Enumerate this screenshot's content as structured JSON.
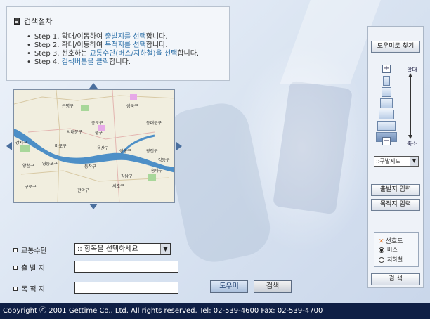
{
  "guide": {
    "title": "검색절차",
    "steps": [
      {
        "pre": "Step 1. 확대/이동하여 ",
        "highlight": "출발지를 선택",
        "post": "합니다."
      },
      {
        "pre": "Step 2. 확대/이동하여 ",
        "highlight": "목적지를 선택",
        "post": "합니다."
      },
      {
        "pre": "Step 3. 선호하는 ",
        "highlight": "교통수단(버스/지하철)을 선택",
        "post": "합니다."
      },
      {
        "pre": "Step 4. ",
        "highlight": "검색버튼을 클릭",
        "post": "합니다."
      }
    ]
  },
  "map": {
    "labels": [
      "은평구",
      "성북구",
      "종로구",
      "서대문구",
      "중구",
      "동대문구",
      "마포구",
      "용산구",
      "성동구",
      "광진구",
      "영등포구",
      "동작구",
      "강남구",
      "송파구",
      "강동구",
      "양천구",
      "구로구",
      "관악구",
      "서초구",
      "강서구"
    ]
  },
  "panel": {
    "help_link": "도우미로 찾기",
    "zoom_in_label": "확대",
    "zoom_out_label": "축소",
    "district_select": "::구발지도",
    "set_origin": "출발지 입력",
    "set_destination": "목적지 입력",
    "preference_title": "선호도",
    "option_bus": "버스",
    "option_subway": "지하철",
    "selected_option": "bus",
    "search_button": "검 색",
    "zoom_level": "7단계 중 7단계"
  },
  "form": {
    "transport_label": "교통수단",
    "transport_select": ":: 항목을 선택하세요",
    "origin_label": "출 발 지",
    "origin_value": "",
    "destination_label": "목 적 지",
    "destination_value": "",
    "help_button": "도우미",
    "search_button": "검색"
  },
  "footer": {
    "copyright": "Copyright ⓒ 2001 Gettime Co., Ltd. All rights reserved. Tel: 02-539-4600 Fax: 02-539-4700"
  }
}
